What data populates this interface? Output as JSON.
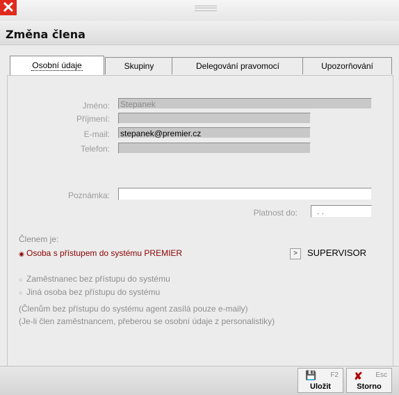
{
  "window": {
    "close_label": "✕",
    "title": "Změna člena"
  },
  "tabs": [
    {
      "label": "Osobní údaje"
    },
    {
      "label": "Skupiny"
    },
    {
      "label": "Delegování pravomocí"
    },
    {
      "label": "Upozorňování"
    }
  ],
  "form": {
    "jmeno": {
      "label": "Jméno:",
      "value": "Stepanek"
    },
    "prijmeni": {
      "label": "Příjmení:",
      "value": ""
    },
    "email": {
      "label": "E-mail:",
      "value": "stepanek@premier.cz"
    },
    "telefon": {
      "label": "Telefon:",
      "value": ""
    },
    "poznamka": {
      "label": "Poznámka:",
      "value": ""
    },
    "platnost": {
      "label": "Platnost do:",
      "value": ". ."
    }
  },
  "membership": {
    "heading": "Členem je:",
    "option_premier": "Osoba s přístupem do systému PREMIER",
    "option_employee": "Zaměstnanec bez přístupu do systému",
    "option_other": "Jiná osoba bez přístupu do systému",
    "note1": "(Členům bez přístupu do systému agent zasílá pouze e-maily)",
    "note2": "(Je-li člen zaměstnancem, přeberou se osobní údaje z personalistiky)",
    "supervisor_button": ">",
    "supervisor_label": "SUPERVISOR"
  },
  "footer": {
    "save": {
      "key": "F2",
      "label": "Uložit",
      "icon": "save-icon"
    },
    "cancel": {
      "key": "Esc",
      "label": "Storno",
      "icon": "cancel-icon"
    }
  },
  "colors": {
    "close": "#e02a1c",
    "selected_option": "#8b0000"
  }
}
